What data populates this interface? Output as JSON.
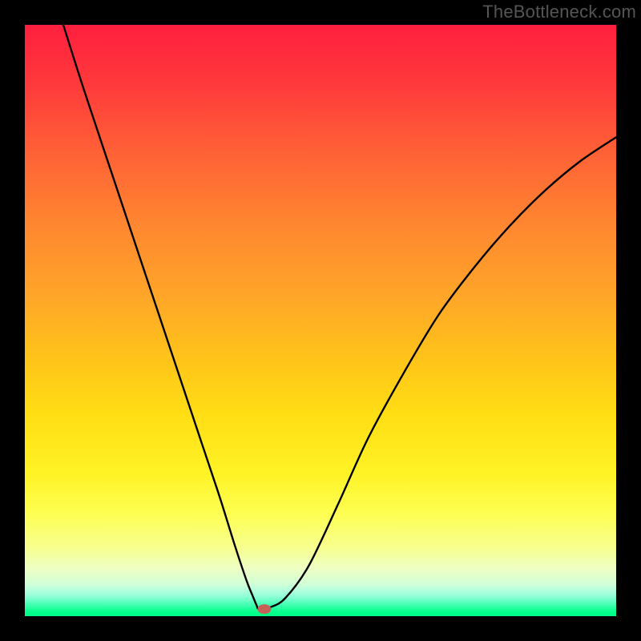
{
  "watermark": "TheBottleneck.com",
  "chart_data": {
    "type": "line",
    "title": "",
    "xlabel": "",
    "ylabel": "",
    "xlim": [
      0,
      1
    ],
    "ylim": [
      0,
      1
    ],
    "note": "Axes unlabeled; values estimated from pixel positions on a 0–1 normalized scale. Curve is a V-shaped bottleneck profile.",
    "series": [
      {
        "name": "curve",
        "x": [
          0.065,
          0.1,
          0.15,
          0.2,
          0.25,
          0.3,
          0.33,
          0.355,
          0.375,
          0.385,
          0.392,
          0.395,
          0.405,
          0.415,
          0.44,
          0.48,
          0.53,
          0.58,
          0.64,
          0.7,
          0.76,
          0.82,
          0.88,
          0.94,
          1.0
        ],
        "y": [
          1.0,
          0.89,
          0.74,
          0.59,
          0.44,
          0.29,
          0.2,
          0.12,
          0.06,
          0.035,
          0.018,
          0.012,
          0.012,
          0.015,
          0.03,
          0.085,
          0.19,
          0.3,
          0.41,
          0.51,
          0.59,
          0.66,
          0.72,
          0.77,
          0.81
        ]
      }
    ],
    "marker": {
      "x": 0.405,
      "y": 0.012
    },
    "background_gradient": {
      "top": "#ff1f3e",
      "mid": "#ffe020",
      "bottom": "#00ff87"
    }
  }
}
